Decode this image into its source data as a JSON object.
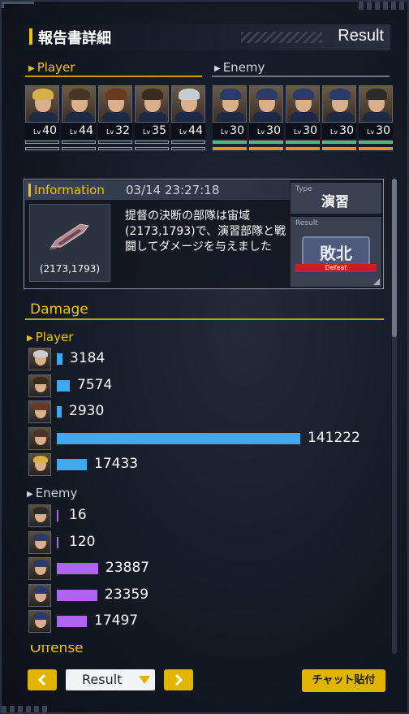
{
  "header": {
    "title": "報告書詳細",
    "result_label": "Result"
  },
  "player": {
    "label": "Player",
    "units": [
      {
        "level_prefix": "Lv",
        "level": "40",
        "hair": "#d7b04a"
      },
      {
        "level_prefix": "Lv",
        "level": "44",
        "hair": "#4a3426"
      },
      {
        "level_prefix": "Lv",
        "level": "32",
        "hair": "#6a3a20"
      },
      {
        "level_prefix": "Lv",
        "level": "35",
        "hair": "#3a2a20"
      },
      {
        "level_prefix": "Lv",
        "level": "44",
        "hair": "#c8ccd4"
      }
    ]
  },
  "enemy": {
    "label": "Enemy",
    "units": [
      {
        "level_prefix": "Lv",
        "level": "30",
        "hair": "#2a3a6a",
        "gauge_color": "#35c07a",
        "gauge2_color": "#e0902a"
      },
      {
        "level_prefix": "Lv",
        "level": "30",
        "hair": "#2a3a6a",
        "gauge_color": "#35c07a",
        "gauge2_color": "#e0902a"
      },
      {
        "level_prefix": "Lv",
        "level": "30",
        "hair": "#2a3a6a",
        "gauge_color": "#35c07a",
        "gauge2_color": "#e0902a"
      },
      {
        "level_prefix": "Lv",
        "level": "30",
        "hair": "#2a3a6a",
        "gauge_color": "#35c07a",
        "gauge2_color": "#e0902a"
      },
      {
        "level_prefix": "Lv",
        "level": "30",
        "hair": "#2a2a2a",
        "gauge_color": "#35c07a",
        "gauge2_color": "#e0902a"
      }
    ]
  },
  "info": {
    "title": "Information",
    "datetime": "03/14 23:27:18",
    "coord": "(2173,1793)",
    "message": "提督の決断の部隊は宙域(2173,1793)で、演習部隊と戦闘してダメージを与えました",
    "type_label": "Type",
    "type_value": "演習",
    "result_label": "Result",
    "result_value": "敗北",
    "result_sub": "Defeat"
  },
  "damage": {
    "title": "Damage",
    "player_label": "Player",
    "enemy_label": "Enemy",
    "player_rows": [
      {
        "value": 3184,
        "display": "3184",
        "hair": "#c8ccd4"
      },
      {
        "value": 7574,
        "display": "7574",
        "hair": "#3a2a20"
      },
      {
        "value": 2930,
        "display": "2930",
        "hair": "#6a3a20"
      },
      {
        "value": 141222,
        "display": "141222",
        "hair": "#4a3426"
      },
      {
        "value": 17433,
        "display": "17433",
        "hair": "#d7b04a"
      }
    ],
    "enemy_rows": [
      {
        "value": 16,
        "display": "16",
        "hair": "#2a2a2a"
      },
      {
        "value": 120,
        "display": "120",
        "hair": "#2a3a6a"
      },
      {
        "value": 23887,
        "display": "23887",
        "hair": "#2a3a6a"
      },
      {
        "value": 23359,
        "display": "23359",
        "hair": "#2a3a6a"
      },
      {
        "value": 17497,
        "display": "17497",
        "hair": "#2a3a6a"
      }
    ],
    "max_value": 141222,
    "player_bar_color": "#3fa9f0",
    "enemy_bar_color": "#b062f0"
  },
  "offense_title": "Offense",
  "footer": {
    "select_value": "Result",
    "chat_button": "チャット貼付"
  },
  "colors": {
    "accent": "#f2c200",
    "button": "#e1b400"
  }
}
